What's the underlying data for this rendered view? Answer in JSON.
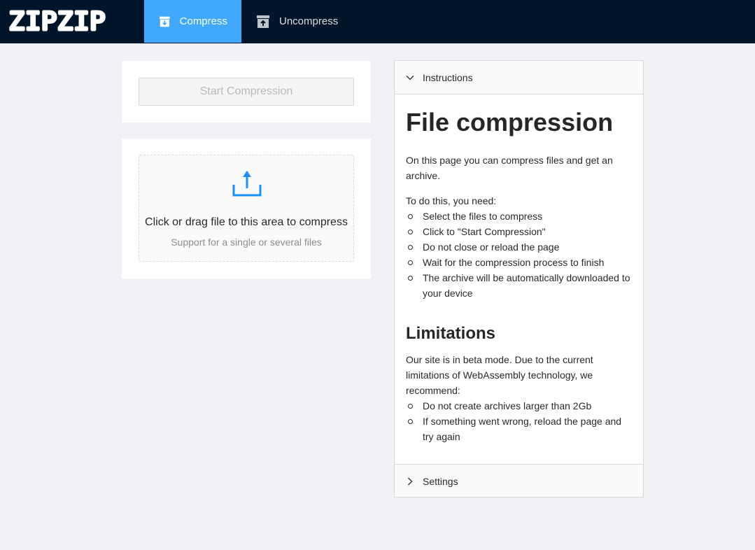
{
  "header": {
    "logo": "ZIPZIP",
    "nav": [
      {
        "label": "Compress",
        "active": true,
        "icon": "archive-down-icon"
      },
      {
        "label": "Uncompress",
        "active": false,
        "icon": "archive-up-icon"
      }
    ]
  },
  "compress": {
    "start_button": "Start Compression"
  },
  "upload": {
    "icon": "upload-icon",
    "text": "Click or drag file to this area to compress",
    "hint": "Support for a single or several files"
  },
  "instructions": {
    "panel_title": "Instructions",
    "title": "File compression",
    "intro": "On this page you can compress files and get an archive.",
    "steps_intro": "To do this, you need:",
    "steps": [
      "Select the files to compress",
      "Click to \"Start Compression\"",
      "Do not close or reload the page",
      "Wait for the compression process to finish",
      "The archive will be automatically downloaded to your device"
    ],
    "limitations_title": "Limitations",
    "limitations_text": "Our site is in beta mode. Due to the current limitations of WebAssembly technology, we recommend:",
    "limitations": [
      "Do not create archives larger than 2Gb",
      "If something went wrong, reload the page and try again"
    ]
  },
  "settings": {
    "panel_title": "Settings"
  },
  "colors": {
    "header_bg": "#001529",
    "accent": "#40a9ff",
    "icon_blue": "#1890ff"
  }
}
